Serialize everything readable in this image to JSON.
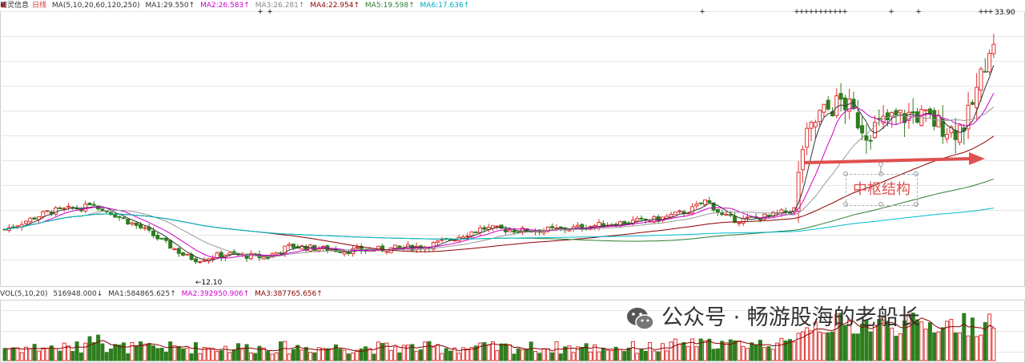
{
  "header": {
    "title": "初灵信息",
    "period": "日线",
    "ma_label": "MA(5,10,20,60,120,250)",
    "ma_values": [
      {
        "label": "MA1:",
        "value": "29.550↑",
        "color": "#333333"
      },
      {
        "label": "MA2:",
        "value": "26.583↑",
        "color": "#cc00cc"
      },
      {
        "label": "MA3:",
        "value": "26.281↑",
        "color": "#888888"
      },
      {
        "label": "MA4:",
        "value": "22.954↑",
        "color": "#8b0000"
      },
      {
        "label": "MA5:",
        "value": "19.598↑",
        "color": "#2e7d32"
      },
      {
        "label": "MA6:",
        "value": "17.636↑",
        "color": "#00bcd4"
      }
    ]
  },
  "volume_header": {
    "label": "VOL(5,10,20)",
    "value": "516948.000↓",
    "ma_values": [
      {
        "label": "MA1:",
        "value": "584865.625↑",
        "color": "#333333"
      },
      {
        "label": "MA2:",
        "value": "392950.906↑",
        "color": "#cc00cc"
      },
      {
        "label": "MA3:",
        "value": "387765.656↑",
        "color": "#8b0000"
      }
    ]
  },
  "annotations": {
    "high_label": "33.90",
    "low_label": "←12.10",
    "callout_text": "中枢结构"
  },
  "watermark": {
    "text": "公众号 · 畅游股海的老船长"
  },
  "colors": {
    "up": "#e03030",
    "down": "#2e7d1e",
    "arrow": "#e05050",
    "grid": "#e6e6e6"
  },
  "chart_data": {
    "type": "candlestick",
    "title": "初灵信息 日线",
    "ylim": [
      11,
      35
    ],
    "high": 33.9,
    "low": 12.1,
    "moving_averages": [
      {
        "name": "MA1",
        "period": 5,
        "last": 29.55
      },
      {
        "name": "MA2",
        "period": 10,
        "last": 26.583
      },
      {
        "name": "MA3",
        "period": 20,
        "last": 26.281
      },
      {
        "name": "MA4",
        "period": 60,
        "last": 22.954
      },
      {
        "name": "MA5",
        "period": 120,
        "last": 19.598
      },
      {
        "name": "MA6",
        "period": 250,
        "last": 17.636
      }
    ],
    "volume": {
      "last": 516948.0,
      "ma": [
        584865.625,
        392950.906,
        387765.656
      ]
    }
  }
}
